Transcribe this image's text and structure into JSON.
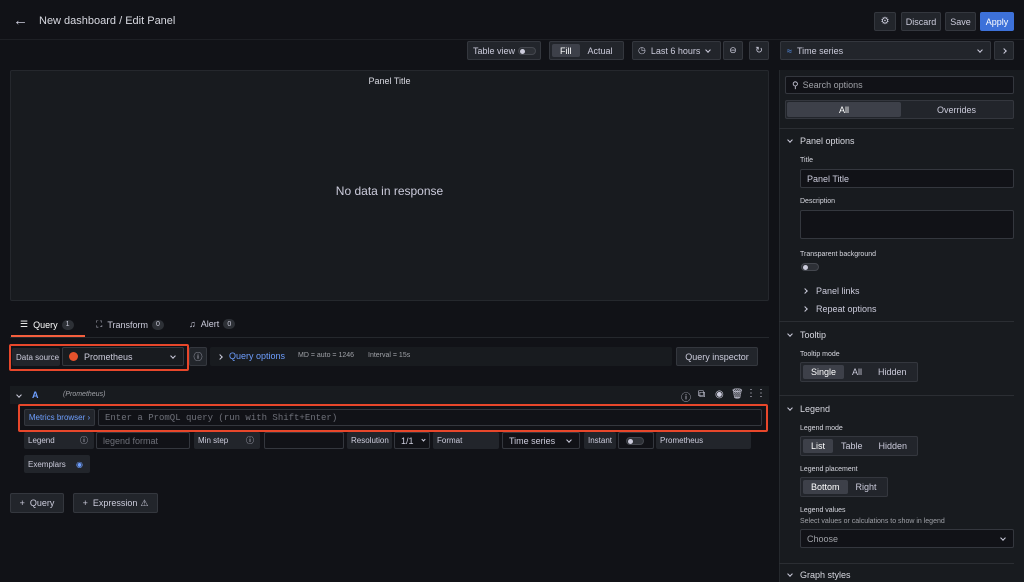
{
  "header": {
    "back_icon": "arrow-left-icon",
    "title": "New dashboard / Edit Panel",
    "discard": "Discard",
    "save": "Save",
    "apply": "Apply",
    "gear_icon": "gear-icon"
  },
  "toolbar": {
    "table_view": "Table view",
    "fill": "Fill",
    "actual": "Actual",
    "time_range": "Last 6 hours",
    "zoom_icon": "zoom-out-icon",
    "refresh_icon": "refresh-icon",
    "viz": "Time series"
  },
  "panel": {
    "title": "Panel Title",
    "empty": "No data in response"
  },
  "tabs": [
    {
      "label": "Query",
      "count": "1"
    },
    {
      "label": "Transform",
      "count": "0"
    },
    {
      "label": "Alert",
      "count": "0"
    }
  ],
  "query_row": {
    "data_source_label": "Data source",
    "data_source": "Prometheus",
    "query_options": "Query options",
    "md": "MD = auto = 1246",
    "interval": "Interval = 15s",
    "inspector": "Query inspector"
  },
  "query_a": {
    "letter": "A",
    "ds": "(Prometheus)",
    "metrics_browser": "Metrics browser",
    "placeholder": "Enter a PromQL query (run with Shift+Enter)",
    "legend": "Legend",
    "legend_placeholder": "legend format",
    "min_step": "Min step",
    "resolution": "Resolution",
    "resolution_val": "1/1",
    "format": "Format",
    "format_val": "Time series",
    "instant": "Instant",
    "ds_name": "Prometheus",
    "exemplars": "Exemplars"
  },
  "add": {
    "query": "Query",
    "expression": "Expression"
  },
  "options": {
    "search_placeholder": "Search options",
    "all": "All",
    "overrides": "Overrides",
    "panel_options": "Panel options",
    "title_label": "Title",
    "title_value": "Panel Title",
    "description": "Description",
    "transparent": "Transparent background",
    "panel_links": "Panel links",
    "repeat": "Repeat options",
    "tooltip": "Tooltip",
    "tooltip_mode": "Tooltip mode",
    "tooltip_modes": [
      "Single",
      "All",
      "Hidden"
    ],
    "legend": "Legend",
    "legend_mode": "Legend mode",
    "legend_modes": [
      "List",
      "Table",
      "Hidden"
    ],
    "legend_placement": "Legend placement",
    "placements": [
      "Bottom",
      "Right"
    ],
    "legend_values": "Legend values",
    "legend_values_desc": "Select values or calculations to show in legend",
    "choose": "Choose",
    "graph_styles": "Graph styles"
  }
}
